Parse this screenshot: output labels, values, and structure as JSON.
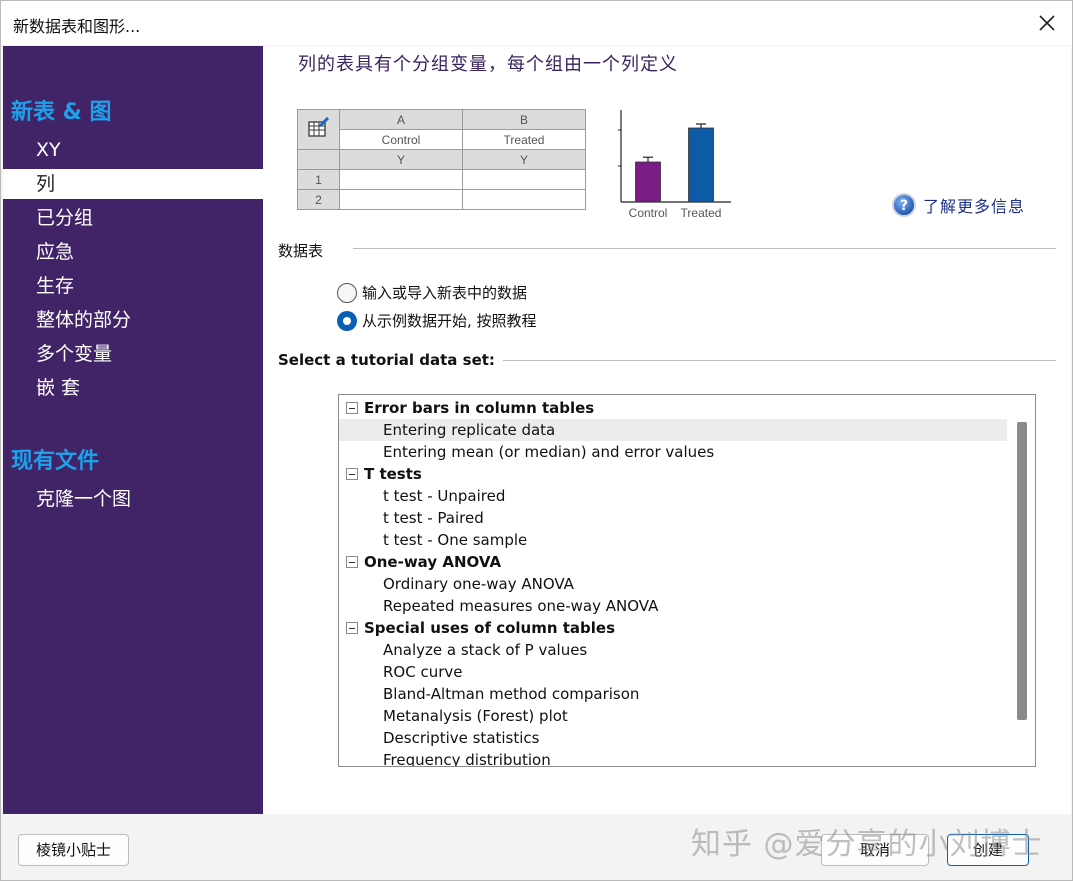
{
  "window": {
    "title": "新数据表和图形..."
  },
  "sidebar": {
    "section_new": "新表 & 图",
    "items": [
      {
        "label": "XY"
      },
      {
        "label": "列"
      },
      {
        "label": "已分组"
      },
      {
        "label": "应急"
      },
      {
        "label": "生存"
      },
      {
        "label": "整体的部分"
      },
      {
        "label": "多个变量"
      },
      {
        "label": "嵌 套"
      }
    ],
    "selected": "列",
    "section_existing": "现有文件",
    "existing_items": [
      {
        "label": "克隆一个图"
      }
    ]
  },
  "main": {
    "heading": "列的表具有个分组变量，每个组由一个列定义",
    "preview_table": {
      "col_letters": [
        "A",
        "B"
      ],
      "col_titles": [
        "Control",
        "Treated"
      ],
      "col_sub": [
        "Y",
        "Y"
      ],
      "rows": [
        "1",
        "2"
      ]
    },
    "learn_more": "了解更多信息",
    "data_table_label": "数据表",
    "radio_options": [
      {
        "label": "输入或导入新表中的数据",
        "checked": false
      },
      {
        "label": "从示例数据开始, 按照教程",
        "checked": true
      }
    ],
    "tutorial_label": "Select a tutorial data set:",
    "tutorial_groups": [
      {
        "title": "Error bars in column tables",
        "items": [
          "Entering replicate data",
          "Entering mean (or median) and error values"
        ]
      },
      {
        "title": "T tests",
        "items": [
          "t test - Unpaired",
          "t test - Paired",
          "t test - One sample"
        ]
      },
      {
        "title": "One-way ANOVA",
        "items": [
          "Ordinary one-way ANOVA",
          "Repeated measures one-way ANOVA"
        ]
      },
      {
        "title": "Special uses of column tables",
        "items": [
          "Analyze a stack of P values",
          "ROC curve",
          "Bland-Altman method comparison",
          "Metanalysis (Forest) plot",
          "Descriptive statistics",
          "Frequency distribution"
        ]
      }
    ],
    "highlighted_item": "Entering replicate data"
  },
  "chart_data": {
    "type": "bar",
    "categories": [
      "Control",
      "Treated"
    ],
    "values": [
      1.0,
      1.85
    ],
    "errors": [
      0.12,
      0.1
    ],
    "colors": [
      "#7a1c86",
      "#0d5aa7"
    ],
    "ylim": [
      0,
      2.3
    ]
  },
  "footer": {
    "tips_button": "棱镜小贴士",
    "cancel_button": "取消",
    "create_button": "创建"
  },
  "watermark": "知乎 @爱分享的小刘博士"
}
